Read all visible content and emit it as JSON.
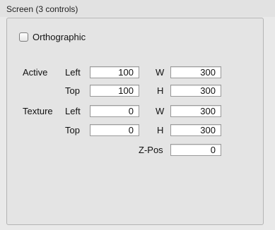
{
  "header": {
    "title": "Screen (3 controls)"
  },
  "orthographic": {
    "label": "Orthographic",
    "checked": false
  },
  "labels": {
    "active": "Active",
    "texture": "Texture",
    "left": "Left",
    "top": "Top",
    "w": "W",
    "h": "H",
    "zpos": "Z-Pos"
  },
  "active": {
    "left": "100",
    "top": "100",
    "w": "300",
    "h": "300"
  },
  "texture": {
    "left": "0",
    "top": "0",
    "w": "300",
    "h": "300"
  },
  "zpos": "0"
}
